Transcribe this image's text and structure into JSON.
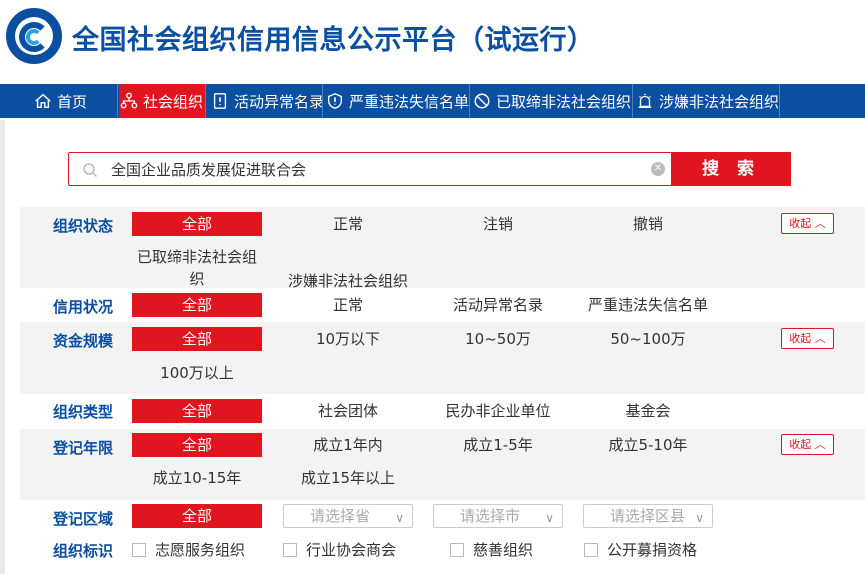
{
  "header": {
    "title": "全国社会组织信用信息公示平台（试运行）"
  },
  "colors": {
    "brand_blue": "#0b4fa0",
    "accent_red": "#e0151f"
  },
  "nav": {
    "items": [
      {
        "label": "首页",
        "icon": "home-icon",
        "active": false
      },
      {
        "label": "社会组织",
        "icon": "org-chart-icon",
        "active": true
      },
      {
        "label": "活动异常名录",
        "icon": "document-alert-icon",
        "active": false
      },
      {
        "label": "严重违法失信名单",
        "icon": "shield-alert-icon",
        "active": false
      },
      {
        "label": "已取缔非法社会组织",
        "icon": "ban-icon",
        "active": false
      },
      {
        "label": "涉嫌非法社会组织",
        "icon": "alarm-icon",
        "active": false
      }
    ]
  },
  "search": {
    "value": "全国企业品质发展促进联合会",
    "button_label": "搜 索"
  },
  "filters": {
    "collapse_label": "收起",
    "org_status": {
      "label": "组织状态",
      "options": [
        "全部",
        "正常",
        "注销",
        "撤销",
        "已取缔非法社会组织",
        "涉嫌非法社会组织"
      ]
    },
    "credit_status": {
      "label": "信用状况",
      "options": [
        "全部",
        "正常",
        "活动异常名录",
        "严重违法失信名单"
      ]
    },
    "capital": {
      "label": "资金规模",
      "options": [
        "全部",
        "10万以下",
        "10~50万",
        "50~100万",
        "100万以上"
      ]
    },
    "org_type": {
      "label": "组织类型",
      "options": [
        "全部",
        "社会团体",
        "民办非企业单位",
        "基金会"
      ]
    },
    "reg_years": {
      "label": "登记年限",
      "options": [
        "全部",
        "成立1年内",
        "成立1-5年",
        "成立5-10年",
        "成立10-15年",
        "成立15年以上"
      ]
    },
    "reg_region": {
      "label": "登记区域",
      "all": "全部",
      "province_placeholder": "请选择省",
      "city_placeholder": "请选择市",
      "district_placeholder": "请选择区县"
    },
    "org_marks": {
      "label": "组织标识",
      "options": [
        "志愿服务组织",
        "行业协会商会",
        "慈善组织",
        "公开募捐资格"
      ]
    }
  }
}
